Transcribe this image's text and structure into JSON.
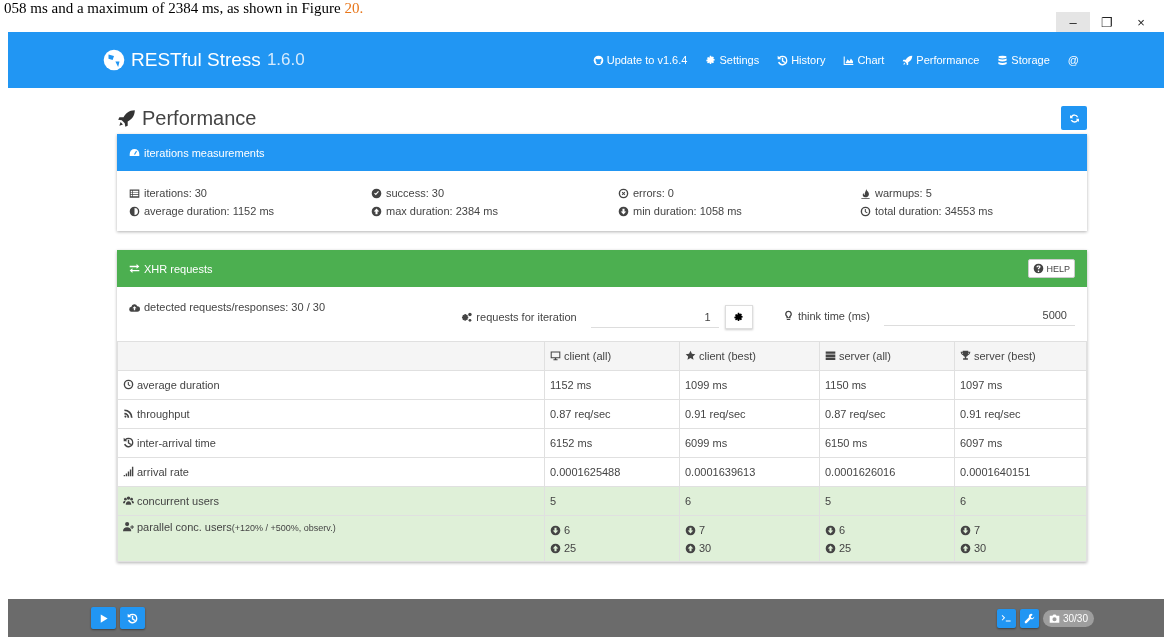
{
  "document_line": {
    "text": "058 ms and a maximum of 2384 ms, as shown in Figure ",
    "link": "20."
  },
  "window_controls": [
    "–",
    "❐",
    "×"
  ],
  "app": {
    "title": "RESTful Stress",
    "version": "1.6.0"
  },
  "nav": [
    {
      "label": "Update to v1.6.4"
    },
    {
      "label": "Settings"
    },
    {
      "label": "History"
    },
    {
      "label": "Chart"
    },
    {
      "label": "Performance"
    },
    {
      "label": "Storage"
    },
    {
      "label": "@"
    }
  ],
  "page_title": "Performance",
  "measurements": {
    "title": "iterations measurements",
    "items": [
      {
        "label": "iterations: 30"
      },
      {
        "label": "success: 30"
      },
      {
        "label": "errors: 0"
      },
      {
        "label": "warmups: 5"
      },
      {
        "label": "average duration: 1152 ms"
      },
      {
        "label": "max duration: 2384 ms"
      },
      {
        "label": "min duration: 1058 ms"
      },
      {
        "label": "total duration: 34553 ms"
      }
    ]
  },
  "xhr": {
    "title": "XHR requests",
    "help": "HELP",
    "detected": "detected requests/responses: 30 / 30",
    "requests_label": "requests for iteration",
    "requests_value": "1",
    "think_label": "think time (ms)",
    "think_value": "5000",
    "columns": [
      "client (all)",
      "client (best)",
      "server (all)",
      "server (best)"
    ],
    "rows": [
      {
        "kind": "plain",
        "label": "average duration",
        "highlighted": false,
        "cells": [
          "1152 ms",
          "1099 ms",
          "1150 ms",
          "1097 ms"
        ]
      },
      {
        "kind": "plain",
        "label": "throughput",
        "highlighted": false,
        "cells": [
          "0.87 req/sec",
          "0.91 req/sec",
          "0.87 req/sec",
          "0.91 req/sec"
        ]
      },
      {
        "kind": "plain",
        "label": "inter-arrival time",
        "highlighted": false,
        "cells": [
          "6152 ms",
          "6099 ms",
          "6150 ms",
          "6097 ms"
        ]
      },
      {
        "kind": "plain",
        "label": "arrival rate",
        "highlighted": false,
        "cells": [
          "0.0001625488",
          "0.0001639613",
          "0.0001626016",
          "0.0001640151"
        ]
      },
      {
        "kind": "plain",
        "label": "concurrent users",
        "highlighted": true,
        "cells": [
          "5",
          "6",
          "5",
          "6"
        ]
      },
      {
        "kind": "range",
        "label": "parallel conc. users",
        "note": "(+120% / +500%, observ.)",
        "highlighted": true,
        "cells": [
          {
            "low": "6",
            "high": "25"
          },
          {
            "low": "7",
            "high": "30"
          },
          {
            "low": "6",
            "high": "25"
          },
          {
            "low": "7",
            "high": "30"
          }
        ]
      }
    ]
  },
  "footer": {
    "badge": "30/30"
  }
}
